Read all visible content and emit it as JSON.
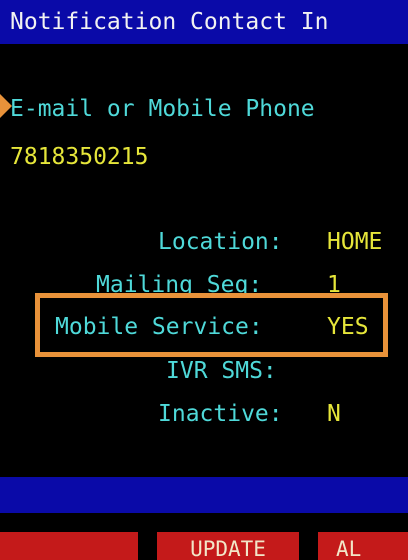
{
  "screen": {
    "title": "Notification Contact In",
    "contact_label": "E-mail or Mobile Phone",
    "contact_value": "7818350215",
    "fields": [
      {
        "label": "Location:",
        "value": "HOME"
      },
      {
        "label": "Mailing Seq:",
        "value": "1"
      },
      {
        "label": "Mobile Service:",
        "value": "YES"
      },
      {
        "label": "IVR SMS:",
        "value": ""
      },
      {
        "label": "Inactive:",
        "value": "N"
      }
    ],
    "function_keys": [
      "",
      "UPDATE",
      "AL"
    ]
  },
  "colors": {
    "background": "#000000",
    "title_bar": "#0a0aa8",
    "label_text": "#4fd9d9",
    "value_text": "#e6e63a",
    "function_key": "#c41a1a",
    "highlight": "#e8923a"
  }
}
